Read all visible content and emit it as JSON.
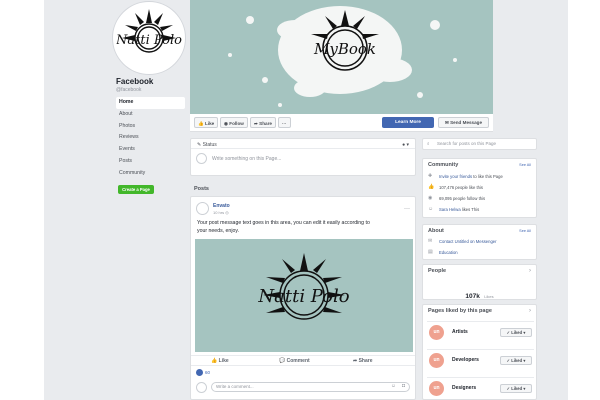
{
  "page": {
    "name": "Facebook",
    "handle": "@facebook"
  },
  "profile_logo_text": "Natti Polo",
  "cover_logo_text": "MyBook",
  "nav": [
    {
      "label": "Home",
      "active": true
    },
    {
      "label": "About"
    },
    {
      "label": "Photos"
    },
    {
      "label": "Reviews"
    },
    {
      "label": "Events"
    },
    {
      "label": "Posts"
    },
    {
      "label": "Community"
    }
  ],
  "create_page_label": "Create a Page",
  "action_bar": {
    "like": "Like",
    "follow": "Follow",
    "share": "Share",
    "more": "···",
    "learn_more": "Learn More",
    "send_message": "Send Message"
  },
  "status": {
    "tab": "Status",
    "placeholder": "Write something on this Page..."
  },
  "posts_heading": "Posts",
  "post": {
    "author": "Envato",
    "time": "10 hrs",
    "text": "Your post message text goes in this area, you can edit it easily according to your needs, enjoy.",
    "like": "Like",
    "comment": "Comment",
    "share": "Share",
    "likes_count": "60",
    "comment_placeholder": "Write a comment..."
  },
  "search": {
    "placeholder": "Search for posts on this Page"
  },
  "community": {
    "title": "Community",
    "see_all": "See All",
    "invite_link": "Invite your friends",
    "invite_rest": "to like this Page",
    "likes": "107,476 people like this",
    "follows": "69,095 people follow this",
    "liker_name": "Sara Helwa",
    "liker_rest": "likes This"
  },
  "about": {
    "title": "About",
    "see_all": "See All",
    "contact": "Contact Untitled on Messenger",
    "category": "Education"
  },
  "people": {
    "title": "People",
    "count": "107k",
    "count_label": "Likes"
  },
  "pages_liked": {
    "title": "Pages liked by this page",
    "items": [
      {
        "avatar": "un",
        "name": "Artists",
        "button": "✓ Liked ▾"
      },
      {
        "avatar": "un",
        "name": "Developers",
        "button": "✓ Liked ▾"
      },
      {
        "avatar": "un",
        "name": "Designers",
        "button": "✓ Liked ▾"
      }
    ]
  },
  "colors": {
    "accent": "#4267b2",
    "cover": "#a5c4c0",
    "create_button": "#42b72a",
    "page_avatar": "#efa18f"
  }
}
